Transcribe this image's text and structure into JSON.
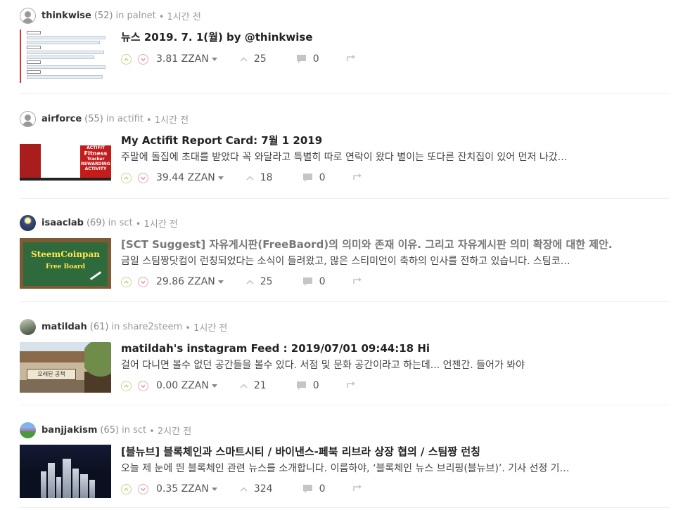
{
  "posts": [
    {
      "author": {
        "name": "thinkwise",
        "rep": "(52)",
        "in_text": "in palnet",
        "time": "• 1시간 전"
      },
      "title": "뉴스 2019. 7. 1(월) by @thinkwise",
      "excerpt": "",
      "payout": "3.81 ZZAN",
      "votes": "25",
      "comments": "0"
    },
    {
      "author": {
        "name": "airforce",
        "rep": "(55)",
        "in_text": "in actifit",
        "time": "• 1시간 전"
      },
      "title": "My Actifit Report Card: 7월 1 2019",
      "excerpt": "주말에 돌집에 초대를 받았다 꼭 와달라고 특별히 따로 연락이 왔다 별이는 또다른 잔치집이 있어 먼저 나갔…",
      "payout": "39.44 ZZAN",
      "votes": "18",
      "comments": "0",
      "thumb_text": [
        "ACTIFIT",
        "FItness",
        "Tracker",
        "REWARDING",
        "ACTIVITY"
      ]
    },
    {
      "author": {
        "name": "isaaclab",
        "rep": "(69)",
        "in_text": "in sct",
        "time": "• 1시간 전"
      },
      "title": "[SCT Suggest] 자유게시판(FreeBaord)의 의미와 존재 이유. 그리고 자유게시판 의미 확장에 대한 제안.",
      "excerpt": "금일 스팀짱닷컴이 런칭되었다는 소식이 들려왔고, 많은 스티미언이 축하의 인사를 전하고 있습니다. 스팀코…",
      "payout": "29.86 ZZAN",
      "votes": "25",
      "comments": "0",
      "thumb_text": [
        "SteemCoinpan",
        "Free Board"
      ]
    },
    {
      "author": {
        "name": "matildah",
        "rep": "(61)",
        "in_text": "in share2steem",
        "time": "• 1시간 전"
      },
      "title": "matildah's instagram Feed : 2019/07/01 09:44:18 Hi",
      "excerpt": "걸어 다니면 볼수 없던 공간들을 볼수 있다. 서점 및 문화 공간이라고 하는데... 언젠간. 들어가 봐야",
      "payout": "0.00 ZZAN",
      "votes": "21",
      "comments": "0",
      "thumb_text": [
        "오래된 공책"
      ]
    },
    {
      "author": {
        "name": "banjjakism",
        "rep": "(65)",
        "in_text": "in sct",
        "time": "• 2시간 전"
      },
      "title": "[블뉴브] 블록체인과 스마트시티 / 바이낸스-페북 리브라 상장 협의 / 스팀짱 런칭",
      "excerpt": "오늘 제 눈에 띈 블록체인 관련 뉴스를 소개합니다. 이름하야, ‘블록체인 뉴스 브리핑(블뉴브)’. 기사 선정 기…",
      "payout": "0.35 ZZAN",
      "votes": "324",
      "comments": "0"
    }
  ],
  "colors": {
    "upvote": "#c7d98a",
    "downvote": "#e7a8ae",
    "icon_gray": "#bbbbbb"
  }
}
